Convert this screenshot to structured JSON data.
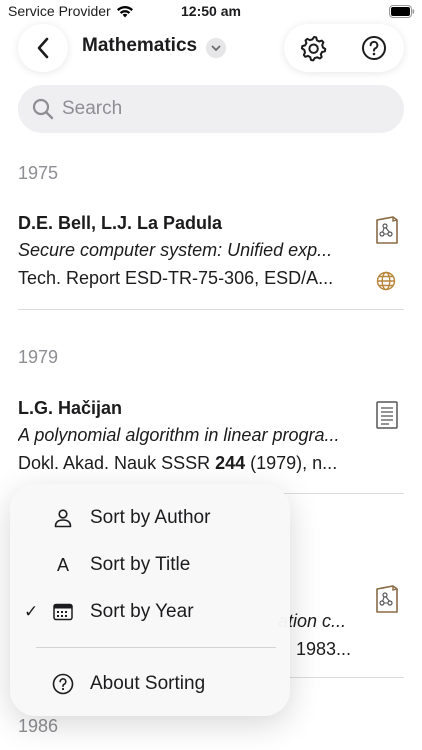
{
  "status_bar": {
    "carrier": "Service Provider",
    "time": "12:50 am"
  },
  "nav": {
    "title": "Mathematics",
    "icons": {
      "back": "chevron-left-icon",
      "title_menu": "chevron-down-icon",
      "settings": "gear-icon",
      "help": "question-circle-icon"
    }
  },
  "search": {
    "placeholder": "Search"
  },
  "sections": [
    {
      "year": "1975",
      "entries": [
        {
          "author": "D.E. Bell, L.J. La Padula",
          "title": "Secure computer system: Unified exp...",
          "ref": "Tech. Report ESD-TR-75-306, ESD/A...",
          "doc_icon": "diagram-document-icon",
          "has_globe": true
        }
      ]
    },
    {
      "year": "1979",
      "entries": [
        {
          "author": "L.G. Hačijan",
          "title": "A polynomial algorithm in linear progra...",
          "ref_prefix": "Dokl. Akad. Nauk SSSR ",
          "ref_bold": "244",
          "ref_suffix": " (1979), n...",
          "doc_icon": "text-document-icon",
          "has_globe": false
        }
      ]
    },
    {
      "year": "1983",
      "entries": [
        {
          "title_fragment": "ation c...",
          "ref_fragment": "1983...",
          "doc_icon": "diagram-document-icon"
        }
      ]
    },
    {
      "year": "1986"
    }
  ],
  "sort_menu": {
    "items": [
      {
        "label": "Sort by Author",
        "icon": "person-icon",
        "checked": false
      },
      {
        "label": "Sort by Title",
        "icon": "letter-a-icon",
        "icon_glyph": "A",
        "checked": false
      },
      {
        "label": "Sort by Year",
        "icon": "calendar-icon",
        "checked": true,
        "check_glyph": "✓"
      }
    ],
    "about": {
      "label": "About Sorting",
      "icon": "question-circle-icon"
    }
  },
  "colors": {
    "accent_icon": "#8b6b45",
    "secondary_text": "#8e8e93"
  }
}
